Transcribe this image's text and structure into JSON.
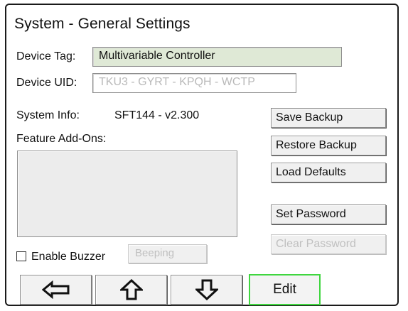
{
  "header": {
    "title": "System - General Settings"
  },
  "device_tag": {
    "label": "Device Tag:",
    "value": "Multivariable Controller"
  },
  "device_uid": {
    "label": "Device UID:",
    "value": "TKU3 - GYRT - KPQH - WCTP"
  },
  "system_info": {
    "label": "System Info:",
    "value": "SFT144 - v2.300"
  },
  "feature_addons": {
    "label": "Feature Add-Ons:",
    "items": []
  },
  "buttons": {
    "save_backup": "Save Backup",
    "restore_backup": "Restore Backup",
    "load_defaults": "Load Defaults",
    "set_password": "Set Password",
    "clear_password": "Clear Password"
  },
  "buzzer": {
    "label": "Enable Buzzer",
    "checked": false,
    "mode_button": "Beeping"
  },
  "nav": {
    "back_icon": "left-arrow-icon",
    "up_icon": "up-arrow-icon",
    "down_icon": "down-arrow-icon",
    "edit_label": "Edit",
    "edit_border_color": "#3fd63f"
  },
  "colors": {
    "tag_field_bg": "#dfe9d6",
    "disabled_text": "#c0c0c0"
  }
}
